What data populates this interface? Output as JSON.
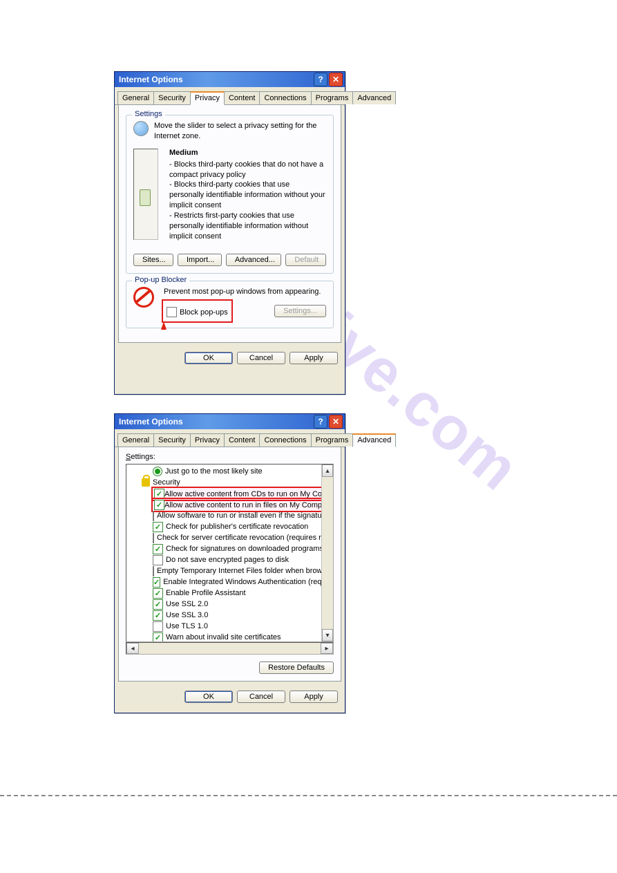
{
  "dialog1": {
    "title": "Internet Options",
    "tabs": [
      "General",
      "Security",
      "Privacy",
      "Content",
      "Connections",
      "Programs",
      "Advanced"
    ],
    "active_tab": "Privacy",
    "settings_group": {
      "legend": "Settings",
      "hint": "Move the slider to select a privacy setting for the Internet zone.",
      "level": "Medium",
      "bullet1": "- Blocks third-party cookies that do not have a compact privacy policy",
      "bullet2": "- Blocks third-party cookies that use personally identifiable information without your implicit consent",
      "bullet3": "- Restricts first-party cookies that use personally identifiable information without implicit consent",
      "buttons": {
        "sites": "Sites...",
        "import": "Import...",
        "advanced": "Advanced...",
        "default": "Default"
      }
    },
    "popup_group": {
      "legend": "Pop-up Blocker",
      "hint": "Prevent most pop-up windows from appearing.",
      "checkbox": "Block pop-ups",
      "settings_btn": "Settings..."
    },
    "dlg_buttons": {
      "ok": "OK",
      "cancel": "Cancel",
      "apply": "Apply"
    }
  },
  "dialog2": {
    "title": "Internet Options",
    "tabs": [
      "General",
      "Security",
      "Privacy",
      "Content",
      "Connections",
      "Programs",
      "Advanced"
    ],
    "active_tab": "Advanced",
    "settings_label": "Settings:",
    "tree": {
      "row0": "Just go to the most likely site",
      "cat": "Security",
      "items": [
        {
          "label": "Allow active content from CDs to run on My Computer",
          "checked": true,
          "hl": true
        },
        {
          "label": "Allow active content to run in files on My Computer",
          "checked": true,
          "hl": true
        },
        {
          "label": "Allow software to run or install even if the signature is invalid",
          "checked": false
        },
        {
          "label": "Check for publisher's certificate revocation",
          "checked": true
        },
        {
          "label": "Check for server certificate revocation (requires restart)",
          "checked": false
        },
        {
          "label": "Check for signatures on downloaded programs",
          "checked": true
        },
        {
          "label": "Do not save encrypted pages to disk",
          "checked": false
        },
        {
          "label": "Empty Temporary Internet Files folder when browser is closed",
          "checked": false
        },
        {
          "label": "Enable Integrated Windows Authentication (requires restart)",
          "checked": true
        },
        {
          "label": "Enable Profile Assistant",
          "checked": true
        },
        {
          "label": "Use SSL 2.0",
          "checked": true
        },
        {
          "label": "Use SSL 3.0",
          "checked": true
        },
        {
          "label": "Use TLS 1.0",
          "checked": false
        },
        {
          "label": "Warn about invalid site certificates",
          "checked": true
        }
      ]
    },
    "restore_btn": "Restore Defaults",
    "dlg_buttons": {
      "ok": "OK",
      "cancel": "Cancel",
      "apply": "Apply"
    }
  },
  "watermark": "shive.com"
}
